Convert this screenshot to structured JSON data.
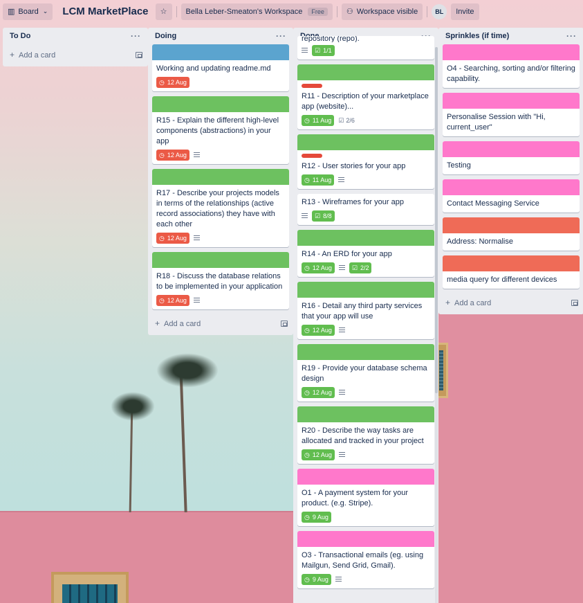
{
  "header": {
    "board_view_label": "Board",
    "board_title": "LCM MarketPlace",
    "workspace_label": "Bella Leber-Smeaton's Workspace",
    "workspace_plan": "Free",
    "visibility_label": "Workspace visible",
    "avatar_initials": "BL",
    "invite_label": "Invite"
  },
  "lists": {
    "todo": {
      "title": "To Do",
      "add_card": "Add a card"
    },
    "doing": {
      "title": "Doing",
      "add_card": "Add a card",
      "cards": [
        {
          "title": "Working and updating readme.md",
          "due": "12 Aug"
        },
        {
          "title": "R15 - Explain the different high-level components (abstractions) in your app",
          "due": "12 Aug"
        },
        {
          "title": "R17 - Describe your projects models in terms of the relationships (active record associations) they have with each other",
          "due": "12 Aug"
        },
        {
          "title": "R18 - Discuss the database relations to be implemented in your application",
          "due": "12 Aug"
        }
      ]
    },
    "done": {
      "title": "Done",
      "cards": [
        {
          "title": "repository (repo).",
          "checklist": "1/1"
        },
        {
          "title": "R11 - Description of your marketplace app (website)...",
          "due": "11 Aug",
          "checklist": "2/6"
        },
        {
          "title": "R12 - User stories for your app",
          "due": "11 Aug"
        },
        {
          "title": "R13 - Wireframes for your app",
          "checklist": "8/8"
        },
        {
          "title": "R14 - An ERD for your app",
          "due": "12 Aug",
          "checklist": "2/2"
        },
        {
          "title": "R16 - Detail any third party services that your app will use",
          "due": "12 Aug"
        },
        {
          "title": "R19 - Provide your database schema design",
          "due": "12 Aug"
        },
        {
          "title": "R20 - Describe the way tasks are allocated and tracked in your project",
          "due": "12 Aug"
        },
        {
          "title": "O1 - A payment system for your product. (e.g. Stripe).",
          "due": "9 Aug"
        },
        {
          "title": "O3 - Transactional emails (eg. using Mailgun, Send Grid, Gmail).",
          "due": "9 Aug"
        }
      ]
    },
    "sprinkles": {
      "title": "Sprinkles (if time)",
      "add_card": "Add a card",
      "cards": [
        {
          "title": "O4 - Searching, sorting and/or filtering capability."
        },
        {
          "title": "Personalise Session with \"Hi, current_user\""
        },
        {
          "title": "Testing"
        },
        {
          "title": "Contact Messaging Service"
        },
        {
          "title": "Address: Normalise"
        },
        {
          "title": "media query for different devices"
        }
      ]
    }
  },
  "colors": {
    "cover_blue": "#5ba4cf",
    "cover_green": "#61bd4f",
    "cover_pink": "#ff78cb",
    "cover_orange": "#ef6b57",
    "due_overdue": "#eb5a46",
    "due_complete": "#61bd4f",
    "label_red": "#e5493a"
  },
  "icons": {
    "board": "board-icon",
    "star": "star-icon",
    "visibility": "people-icon",
    "clock": "clock-icon",
    "checklist": "checklist-icon",
    "description": "description-icon",
    "template": "template-icon",
    "more": "more-icon"
  }
}
